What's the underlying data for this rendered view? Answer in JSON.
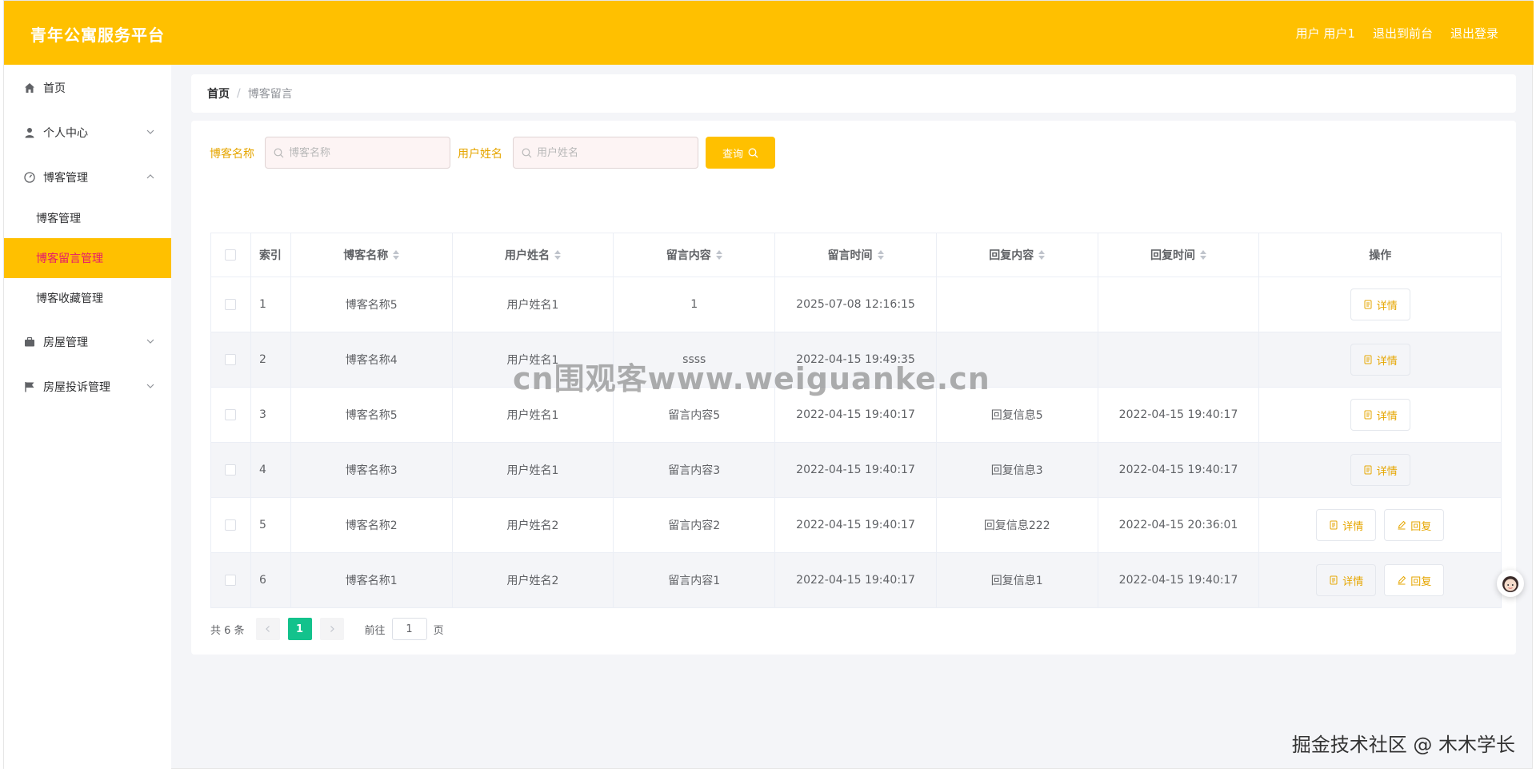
{
  "header": {
    "brand": "青年公寓服务平台",
    "user_label": "用户 用户1",
    "to_front_label": "退出到前台",
    "logout_label": "退出登录"
  },
  "sidebar": {
    "items": [
      {
        "label": "首页",
        "icon": "home-icon"
      },
      {
        "label": "个人中心",
        "icon": "user-icon"
      },
      {
        "label": "博客管理",
        "icon": "dashboard-icon"
      },
      {
        "label": "房屋管理",
        "icon": "briefcase-icon"
      },
      {
        "label": "房屋投诉管理",
        "icon": "flag-icon"
      }
    ],
    "sub_items": [
      {
        "label": "博客管理"
      },
      {
        "label": "博客留言管理"
      },
      {
        "label": "博客收藏管理"
      }
    ]
  },
  "breadcrumb": {
    "home": "首页",
    "separator": "/",
    "current": "博客留言"
  },
  "search": {
    "blog_name_label": "博客名称",
    "blog_name_placeholder": "博客名称",
    "user_name_label": "用户姓名",
    "user_name_placeholder": "用户姓名",
    "query_label": "查询"
  },
  "table": {
    "headers": [
      "索引",
      "博客名称",
      "用户姓名",
      "留言内容",
      "留言时间",
      "回复内容",
      "回复时间",
      "操作"
    ],
    "rows": [
      {
        "index": "1",
        "blog": "博客名称5",
        "user": "用户姓名1",
        "content": "1",
        "time": "2025-07-08 12:16:15",
        "reply": "",
        "reply_time": ""
      },
      {
        "index": "2",
        "blog": "博客名称4",
        "user": "用户姓名1",
        "content": "ssss",
        "time": "2022-04-15 19:49:35",
        "reply": "",
        "reply_time": ""
      },
      {
        "index": "3",
        "blog": "博客名称5",
        "user": "用户姓名1",
        "content": "留言内容5",
        "time": "2022-04-15 19:40:17",
        "reply": "回复信息5",
        "reply_time": "2022-04-15 19:40:17"
      },
      {
        "index": "4",
        "blog": "博客名称3",
        "user": "用户姓名1",
        "content": "留言内容3",
        "time": "2022-04-15 19:40:17",
        "reply": "回复信息3",
        "reply_time": "2022-04-15 19:40:17"
      },
      {
        "index": "5",
        "blog": "博客名称2",
        "user": "用户姓名2",
        "content": "留言内容2",
        "time": "2022-04-15 19:40:17",
        "reply": "回复信息222",
        "reply_time": "2022-04-15 20:36:01"
      },
      {
        "index": "6",
        "blog": "博客名称1",
        "user": "用户姓名2",
        "content": "留言内容1",
        "time": "2022-04-15 19:40:17",
        "reply": "回复信息1",
        "reply_time": "2022-04-15 19:40:17"
      }
    ],
    "detail_label": "详情",
    "reply_label": "回复"
  },
  "pagination": {
    "total": "共 6 条",
    "current_page": "1",
    "goto_label": "前往",
    "goto_value": "1",
    "page_suffix": "页"
  },
  "watermark": "cn围观客www.weiguanke.cn",
  "corner_mark": "掘金技术社区 @ 木木学长",
  "colors": {
    "accent": "#ffc000",
    "active_text": "#e6196b",
    "page_active": "#13c28c"
  }
}
